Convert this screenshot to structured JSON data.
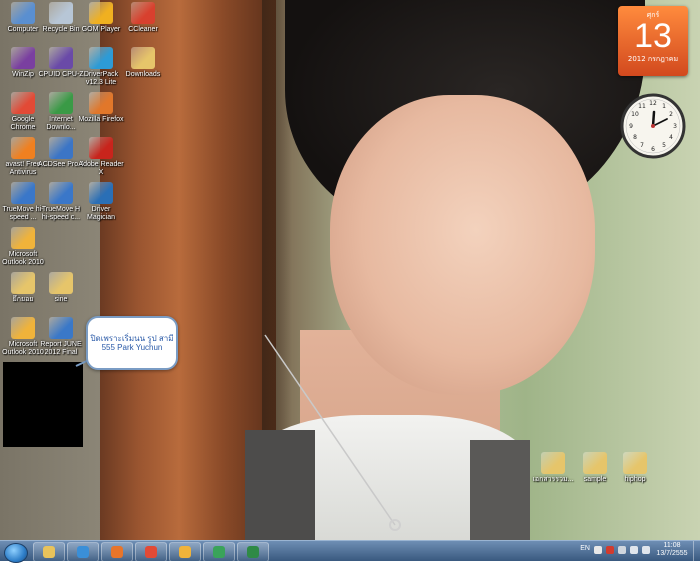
{
  "desktop": {
    "icons": [
      {
        "label": "Computer",
        "color": "#5a8fd0"
      },
      {
        "label": "Recycle Bin",
        "color": "#b7c6d6"
      },
      {
        "label": "GOM Player",
        "color": "#f0b020"
      },
      {
        "label": "CCleaner",
        "color": "#d8402e"
      },
      {
        "label": "WinZip",
        "color": "#7a3fa0"
      },
      {
        "label": "CPUID CPU-Z",
        "color": "#6a4aa8"
      },
      {
        "label": "DriverPack v12.3 Lite",
        "color": "#2d9bd6"
      },
      {
        "label": "Downloads",
        "color": "#e6c56a"
      },
      {
        "label": "Google Chrome",
        "color": "#e24a36"
      },
      {
        "label": "Internet Downlo...",
        "color": "#3a9a46"
      },
      {
        "label": "Mozilla Firefox",
        "color": "#e1772a"
      },
      {
        "label": "avast! Free Antivirus",
        "color": "#f08020"
      },
      {
        "label": "ACDSee Pro 4",
        "color": "#3b75c6"
      },
      {
        "label": "Adobe Reader X",
        "color": "#c8241c"
      },
      {
        "label": "TrueMove hi-speed ...",
        "color": "#3a77c9"
      },
      {
        "label": "TrueMove H hi-speed c...",
        "color": "#3a77c9"
      },
      {
        "label": "Driver Magician",
        "color": "#2a6fb6"
      },
      {
        "label": "Microsoft Outlook 2010",
        "color": "#f0b33a"
      },
      {
        "label": "ยึกยอย",
        "color": "#e6c56a"
      },
      {
        "label": "sine",
        "color": "#e6c56a"
      },
      {
        "label": "Microsoft Outlook 2010",
        "color": "#f0b33a"
      },
      {
        "label": "Report JUNE 2012 Final",
        "color": "#3a78c8"
      },
      {
        "label": "เอกสารรวม...",
        "color": "#e6c56a"
      },
      {
        "label": "sample",
        "color": "#e6c56a"
      },
      {
        "label": "hiphop",
        "color": "#e6c56a"
      }
    ]
  },
  "callout": {
    "text": "ปิดเพราะเริ่มนน รูป สามี 555 Park Yuchun"
  },
  "calendar_gadget": {
    "day": "ศุกร์",
    "date": "13",
    "month_year": "2012 กรกฎาคม"
  },
  "clock_gadget": {
    "time_hint": "11:08"
  },
  "taskbar": {
    "buttons": [
      {
        "name": "explorer",
        "color": "#e9c35b"
      },
      {
        "name": "internet-explorer",
        "color": "#3a8fd8"
      },
      {
        "name": "firefox",
        "color": "#e8752a"
      },
      {
        "name": "chrome",
        "color": "#e24a36"
      },
      {
        "name": "outlook",
        "color": "#f0b33a"
      },
      {
        "name": "network",
        "color": "#3aa35a"
      },
      {
        "name": "excel",
        "color": "#2f8a46"
      }
    ],
    "language": "EN",
    "clock_time": "11:08",
    "clock_date": "13/7/2555"
  }
}
